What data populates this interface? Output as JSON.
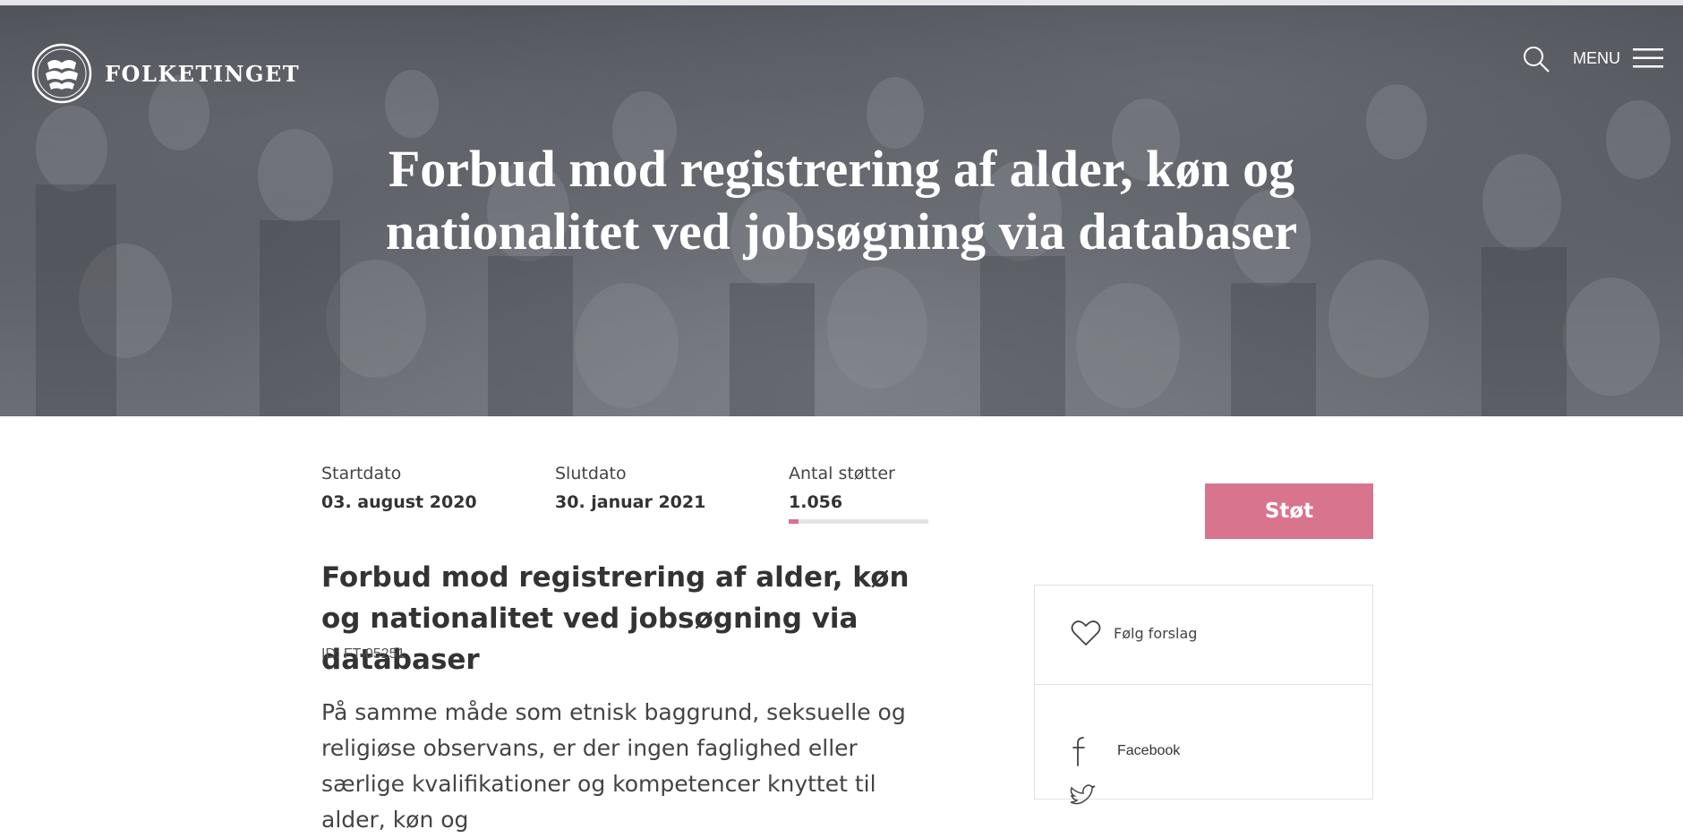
{
  "header": {
    "logo_text": "FOLKETINGET",
    "menu_label": "MENU"
  },
  "hero": {
    "title": "Forbud mod registrering af alder, køn og nationalitet ved jobsøgning via databaser"
  },
  "meta": {
    "start": {
      "label": "Startdato",
      "value": "03. august 2020"
    },
    "end": {
      "label": "Slutdato",
      "value": "30. januar 2021"
    },
    "supporters": {
      "label": "Antal støtter",
      "value": "1.056",
      "progress_fraction": 0.07
    }
  },
  "actions": {
    "support_label": "Støt"
  },
  "proposal": {
    "title": "Forbud mod registrering af alder, køn og nationalitet ved jobsøgning via databaser",
    "id_text": "ID: FT-05251",
    "body": "På samme måde som etnisk baggrund, seksuelle og religiøse observans, er der ingen faglighed eller særlige kvalifikationer og kompetencer knyttet til alder, køn og"
  },
  "sidebar": {
    "follow_label": "Følg forslag",
    "share": [
      {
        "label": "Facebook",
        "icon": "facebook-icon"
      },
      {
        "label": "",
        "icon": "twitter-icon"
      }
    ]
  },
  "colors": {
    "accent": "#d9748f",
    "hero_overlay": "#55575f"
  }
}
